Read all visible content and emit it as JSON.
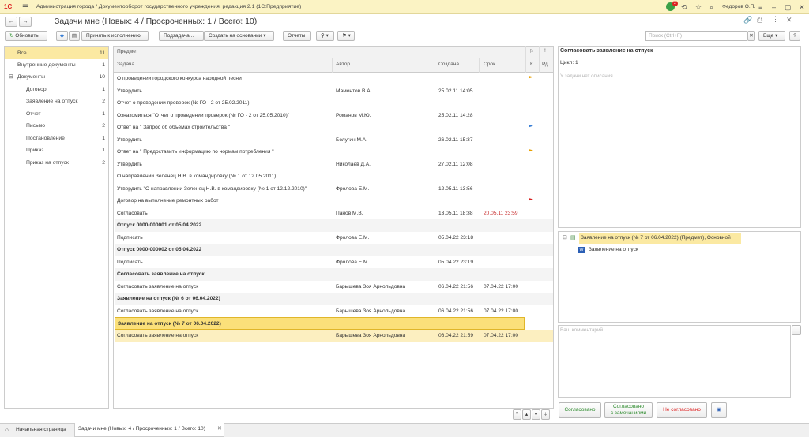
{
  "titlebar": {
    "logo": "1С",
    "title": "Администрация города / Документооборот государственного учреждения, редакция 2.1  (1С:Предприятие)",
    "notify_count": "2",
    "user": "Федоров О.П."
  },
  "header": {
    "title": "Задачи мне (Новых: 4 / Просроченных: 1 / Всего: 10)"
  },
  "toolbar": {
    "refresh": "Обновить",
    "accept": "Принять к исполнению",
    "subtask": "Подзадача...",
    "create_based": "Создать на основании",
    "reports": "Отчеты",
    "search_placeholder": "Поиск (Ctrl+F)",
    "more": "Еще",
    "help": "?"
  },
  "sidebar": {
    "items": [
      {
        "label": "Все",
        "count": "11"
      },
      {
        "label": "Внутренние документы",
        "count": "1"
      },
      {
        "label": "Документы",
        "count": "10"
      },
      {
        "label": "Договор",
        "count": "1"
      },
      {
        "label": "Заявление на отпуск",
        "count": "2"
      },
      {
        "label": "Отчет",
        "count": "1"
      },
      {
        "label": "Письмо",
        "count": "2"
      },
      {
        "label": "Постановление",
        "count": "1"
      },
      {
        "label": "Приказ",
        "count": "1"
      },
      {
        "label": "Приказ на отпуск",
        "count": "2"
      }
    ]
  },
  "table": {
    "headers": {
      "subject": "Предмет",
      "task": "Задача",
      "author": "Автор",
      "created": "Создана",
      "deadline": "Срок",
      "k": "К",
      "rd": "Рд"
    },
    "groups": [
      {
        "subject": "О проведении городского конкурса народной песни",
        "task": "Утвердить",
        "author": "Мамонтов В.А.",
        "created": "25.02.11 14:05",
        "deadline": "",
        "flag": "#e8a000",
        "bold": false
      },
      {
        "subject": "Отчет о проведении проверок (№ ГО - 2 от 25.02.2011)",
        "task": "Ознакомиться \"Отчет о проведении проверок (№ ГО - 2 от 25.05.2010)\"",
        "author": "Романов М.Ю.",
        "created": "25.02.11 14:28",
        "deadline": "",
        "flag": "",
        "bold": false
      },
      {
        "subject": "Ответ на \" Запрос об объемах строительства \"",
        "task": "Утвердить",
        "author": "Белугин М.А.",
        "created": "26.02.11 15:37",
        "deadline": "",
        "flag": "#3a7fd5",
        "bold": false
      },
      {
        "subject": "Ответ на \" Предоставить информацию по нормам потребления \"",
        "task": "Утвердить",
        "author": "Николаев Д.А.",
        "created": "27.02.11 12:08",
        "deadline": "",
        "flag": "#e8a000",
        "bold": false
      },
      {
        "subject": "О направлении Зеленец Н.В. в командировку (№ 1 от 12.05.2011)",
        "task": "Утвердить \"О направлении Зеленец Н.В. в командировку (№ 1 от 12.12.2010)\"",
        "author": "Фролова Е.М.",
        "created": "12.05.11 13:56",
        "deadline": "",
        "flag": "",
        "bold": false
      },
      {
        "subject": "Договор на выполнение ремонтных работ",
        "task": "Согласовать",
        "author": "Панов М.В.",
        "created": "13.05.11 18:38",
        "deadline": "20.05.11 23:59",
        "flag": "#d62020",
        "bold": false
      },
      {
        "subject": "Отпуск 0000-000001 от 05.04.2022",
        "task": "Подписать",
        "author": "Фролова Е.М.",
        "created": "05.04.22 23:18",
        "deadline": "",
        "flag": "",
        "bold": true
      },
      {
        "subject": "Отпуск 0000-000002 от 05.04.2022",
        "task": "Подписать",
        "author": "Фролова Е.М.",
        "created": "05.04.22 23:19",
        "deadline": "",
        "flag": "",
        "bold": true
      },
      {
        "subject": "Согласовать заявление на отпуск",
        "task": "Согласовать заявление на отпуск",
        "author": "Барышева Зоя Арнольдовна",
        "created": "06.04.22 21:56",
        "deadline": "07.04.22 17:00",
        "flag": "",
        "bold": true
      },
      {
        "subject": "Заявление на отпуск (№ 6 от 06.04.2022)",
        "task": "Согласовать заявление на отпуск",
        "author": "Барышева Зоя Арнольдовна",
        "created": "06.04.22 21:56",
        "deadline": "07.04.22 17:00",
        "flag": "",
        "bold": true
      },
      {
        "subject": "Заявление на отпуск (№ 7 от 06.04.2022)",
        "task": "Согласовать заявление на отпуск",
        "author": "Барышева Зоя Арнольдовна",
        "created": "06.04.22 21:59",
        "deadline": "07.04.22 17:00",
        "flag": "",
        "bold": true
      }
    ]
  },
  "detail": {
    "title": "Согласовать заявление на отпуск",
    "cycle": "Цикл: 1",
    "no_desc": "У задачи нет описания.",
    "tree_root": "Заявление на отпуск (№ 7 от 06.04.2022) (Предмет), Основной",
    "tree_child": "Заявление на отпуск",
    "comment_placeholder": "Ваш комментарий",
    "ellipsis": "...",
    "buttons": {
      "approve": "Согласовано",
      "approve_remarks_1": "Согласовано",
      "approve_remarks_2": "с замечаниями",
      "reject": "Не согласовано"
    }
  },
  "bottom_tabs": {
    "home": "Начальная страница",
    "current": "Задачи мне (Новых: 4 / Просроченных: 1 / Всего: 10)"
  }
}
